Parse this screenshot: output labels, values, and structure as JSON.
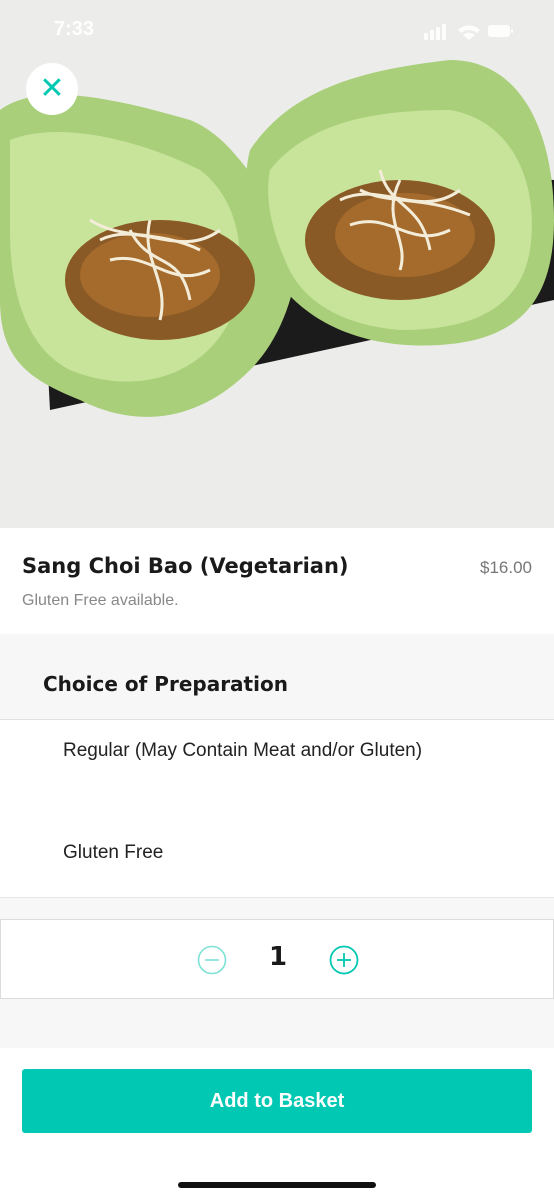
{
  "status_bar": {
    "time": "7:33"
  },
  "hero": {
    "image_alt": ""
  },
  "item": {
    "name": "Sang Choi Bao (Vegetarian)",
    "price": "$16.00",
    "description": "Gluten Free available."
  },
  "choice": {
    "title": "Choice of Preparation",
    "options": [
      {
        "label": "Regular (May Contain Meat and/or Gluten)"
      },
      {
        "label": "Gluten Free"
      }
    ]
  },
  "quantity": {
    "value": "1"
  },
  "footer": {
    "add_button_label": "Add to Basket"
  },
  "colors": {
    "accent": "#00c8b3",
    "background_gray": "#f7f7f7"
  }
}
